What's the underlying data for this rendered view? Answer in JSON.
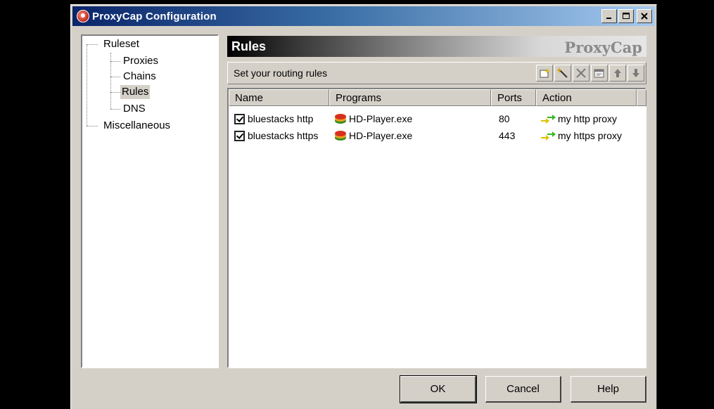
{
  "window": {
    "title": "ProxyCap Configuration",
    "controls": {
      "minimize": "_",
      "maximize": "□",
      "close": "×"
    }
  },
  "tree": {
    "items": [
      {
        "label": "Ruleset"
      },
      {
        "label": "Proxies"
      },
      {
        "label": "Chains"
      },
      {
        "label": "Rules",
        "selected": true
      },
      {
        "label": "DNS"
      },
      {
        "label": "Miscellaneous"
      }
    ]
  },
  "panel": {
    "title": "Rules",
    "brand": "ProxyCap",
    "toolbar_label": "Set your routing rules",
    "tool_icons": [
      "new-rule-icon",
      "wand-icon",
      "delete-icon",
      "properties-icon",
      "move-up-icon",
      "move-down-icon"
    ]
  },
  "list": {
    "columns": [
      "Name",
      "Programs",
      "Ports",
      "Action"
    ],
    "rows": [
      {
        "checked": true,
        "name": "bluestacks http",
        "program": "HD-Player.exe",
        "ports": "80",
        "action": "my http proxy"
      },
      {
        "checked": true,
        "name": "bluestacks https",
        "program": "HD-Player.exe",
        "ports": "443",
        "action": "my https proxy"
      }
    ]
  },
  "buttons": {
    "ok": "OK",
    "cancel": "Cancel",
    "help": "Help"
  },
  "colors": {
    "titlebar_start": "#0a246a",
    "titlebar_end": "#a6caf0",
    "face": "#d4d0c8",
    "action_arrow": "#33bb22"
  }
}
